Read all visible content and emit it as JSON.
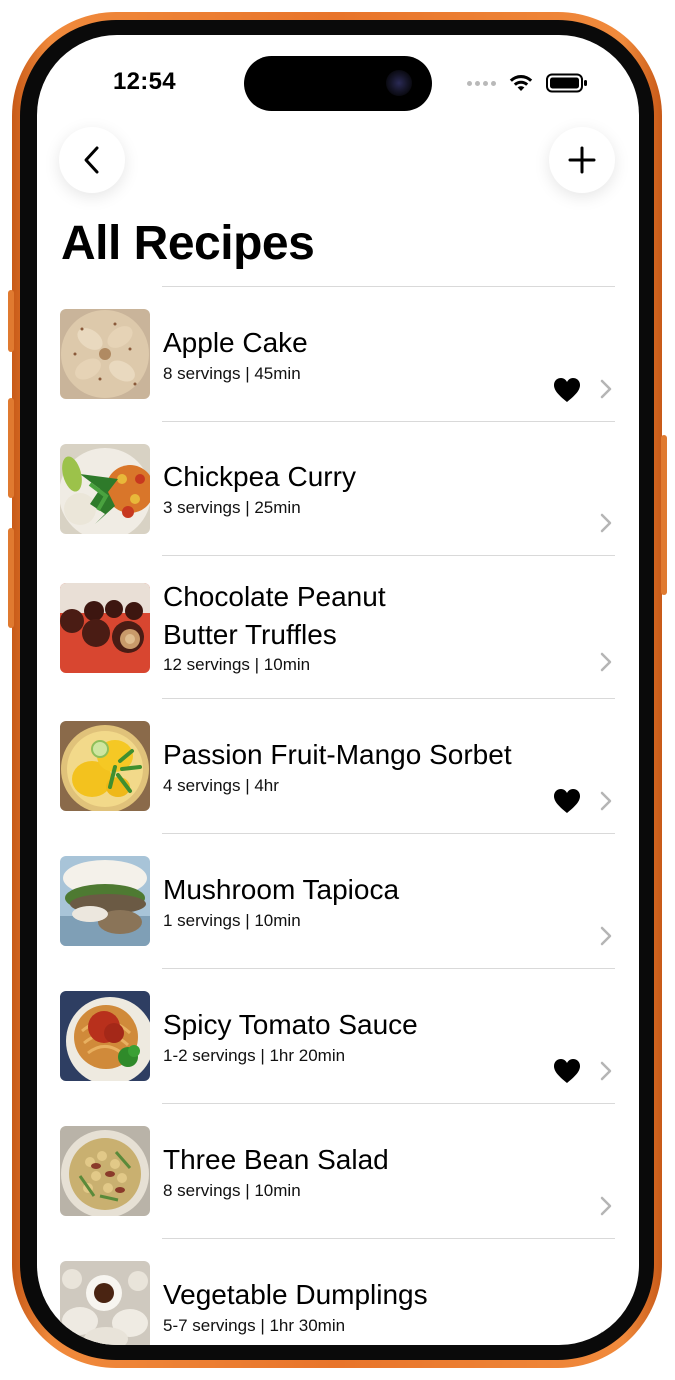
{
  "status_bar": {
    "time": "12:54"
  },
  "header": {
    "title": "All Recipes"
  },
  "nav": {
    "back_icon": "chevron-left-icon",
    "add_icon": "plus-icon"
  },
  "colors": {
    "frame": "#e8742a",
    "text": "#000000",
    "chevron": "#b5b5b5",
    "divider": "#d9d9d9"
  },
  "recipes": [
    {
      "title": "Apple Cake",
      "title_line2": "",
      "subtitle": "8 servings | 45min",
      "favorite": true
    },
    {
      "title": "Chickpea Curry",
      "title_line2": "",
      "subtitle": "3 servings | 25min",
      "favorite": false
    },
    {
      "title": "Chocolate Peanut",
      "title_line2": "Butter Truffles",
      "subtitle": "12 servings | 10min",
      "favorite": false
    },
    {
      "title": "Passion Fruit-Mango Sorbet",
      "title_line2": "",
      "subtitle": "4 servings | 4hr",
      "favorite": true
    },
    {
      "title": "Mushroom Tapioca",
      "title_line2": "",
      "subtitle": "1 servings | 10min",
      "favorite": false
    },
    {
      "title": "Spicy Tomato Sauce",
      "title_line2": "",
      "subtitle": "1-2 servings | 1hr 20min",
      "favorite": true
    },
    {
      "title": "Three Bean Salad",
      "title_line2": "",
      "subtitle": "8 servings | 10min",
      "favorite": false
    },
    {
      "title": "Vegetable Dumplings",
      "title_line2": "",
      "subtitle": "5-7 servings | 1hr 30min",
      "favorite": false
    }
  ]
}
